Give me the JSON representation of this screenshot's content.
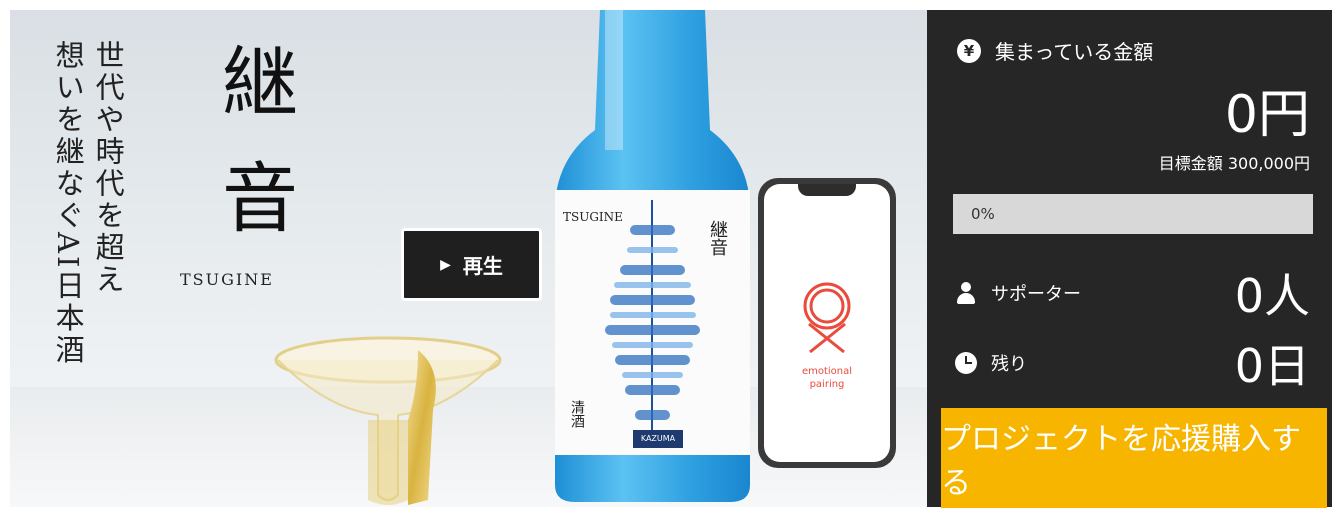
{
  "hero": {
    "vertical_line_1": "世代や時代を超え",
    "vertical_line_2": "想いを継なぐAI日本酒",
    "title": "継音",
    "subtitle": "TSUGINE",
    "play_label": "再生",
    "bottle_label_title": "TSUGINE",
    "bottle_label_kanji": "継音",
    "bottle_label_sake": "清酒",
    "bottle_label_brand": "KAZUMA",
    "phone_text_1": "emotional",
    "phone_text_2": "pairing"
  },
  "panel": {
    "collected_label": "集まっている金額",
    "collected_amount": "0円",
    "goal_label": "目標金額",
    "goal_amount": "300,000円",
    "progress_text": "0%",
    "progress_fraction": 0,
    "supporters_label": "サポーター",
    "supporters_value": "0人",
    "remaining_label": "残り",
    "remaining_value": "0日",
    "cta_label": "プロジェクトを応援購入する"
  },
  "colors": {
    "panel_bg": "#262626",
    "cta_bg": "#f7b500",
    "progress_track": "#d8d8d8",
    "bottle_blue": "#39a7e0",
    "logo_red": "#e94b3c"
  },
  "icons": {
    "collected": "yen-circle-icon",
    "supporters": "person-icon",
    "remaining": "clock-icon",
    "play": "play-triangle-icon"
  }
}
